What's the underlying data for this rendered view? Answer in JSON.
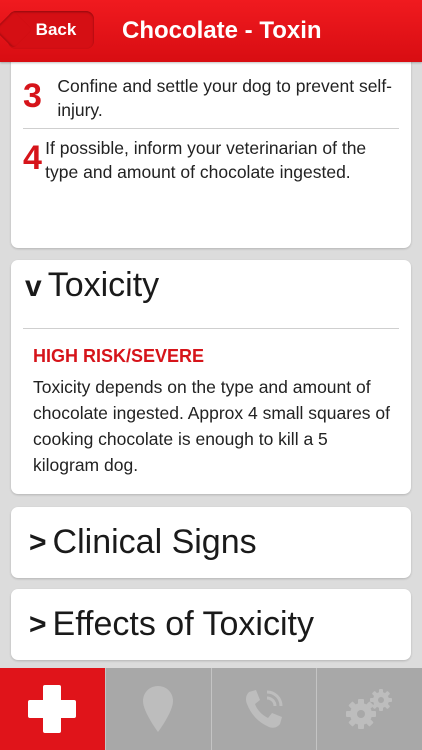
{
  "navbar": {
    "back_label": "Back",
    "title": "Chocolate - Toxin"
  },
  "steps": [
    {
      "number": "3",
      "text": "Confine and settle your dog to prevent self-injury."
    },
    {
      "number": "4",
      "text": "If possible, inform your veterinarian of the type and amount of chocolate ingested."
    }
  ],
  "toxicity": {
    "chevron": "v",
    "title": "Toxicity",
    "risk_label": "HIGH RISK/SEVERE",
    "text": "Toxicity depends on the type and amount of chocolate ingested. Approx 4 small squares of cooking chocolate is enough to kill a 5 kilogram dog."
  },
  "collapsed_sections": [
    {
      "chevron": ">",
      "title": "Clinical Signs"
    },
    {
      "chevron": ">",
      "title": "Effects of Toxicity"
    }
  ],
  "tabs": [
    {
      "icon": "first-aid-cross-icon",
      "active": true
    },
    {
      "icon": "map-pin-icon",
      "active": false
    },
    {
      "icon": "phone-call-icon",
      "active": false
    },
    {
      "icon": "settings-gears-icon",
      "active": false
    }
  ],
  "colors": {
    "accent": "#e0141a",
    "tab_inactive": "#a8a8a8",
    "background": "#dcdcdc"
  }
}
